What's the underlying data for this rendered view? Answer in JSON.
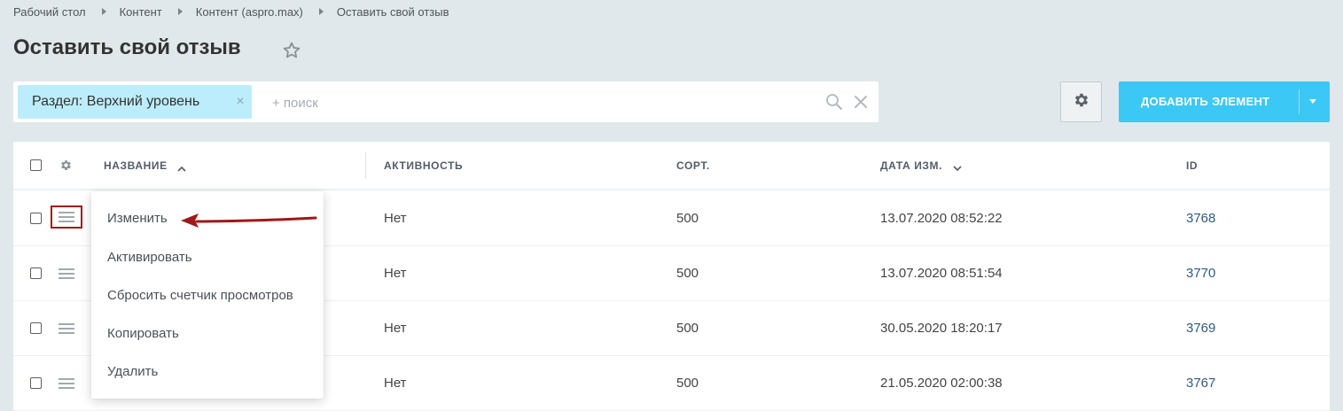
{
  "breadcrumb": [
    "Рабочий стол",
    "Контент",
    "Контент (aspro.max)",
    "Оставить свой отзыв"
  ],
  "page_title": "Оставить свой отзыв",
  "filter": {
    "chip_label": "Раздел: Верхний уровень",
    "chip_close": "×",
    "search_placeholder": "+ поиск"
  },
  "toolbar": {
    "add_label": "ДОБАВИТЬ ЭЛЕМЕНТ"
  },
  "grid": {
    "columns": {
      "name": "НАЗВАНИЕ",
      "active": "АКТИВНОСТЬ",
      "sort": "СОРТ.",
      "date": "ДАТА ИЗМ.",
      "id": "ID"
    },
    "rows": [
      {
        "active": "Нет",
        "sort": "500",
        "date": "13.07.2020 08:52:22",
        "id": "3768"
      },
      {
        "active": "Нет",
        "sort": "500",
        "date": "13.07.2020 08:51:54",
        "id": "3770"
      },
      {
        "active": "Нет",
        "sort": "500",
        "date": "30.05.2020 18:20:17",
        "id": "3769"
      },
      {
        "active": "Нет",
        "sort": "500",
        "date": "21.05.2020 02:00:38",
        "id": "3767"
      }
    ]
  },
  "context_menu": {
    "items": [
      "Изменить",
      "Активировать",
      "Сбросить счетчик просмотров",
      "Копировать",
      "Удалить"
    ]
  },
  "colors": {
    "accent": "#3bc8f5",
    "chip": "#bcedfc",
    "annotation": "#a11818",
    "link": "#2f5b86"
  }
}
